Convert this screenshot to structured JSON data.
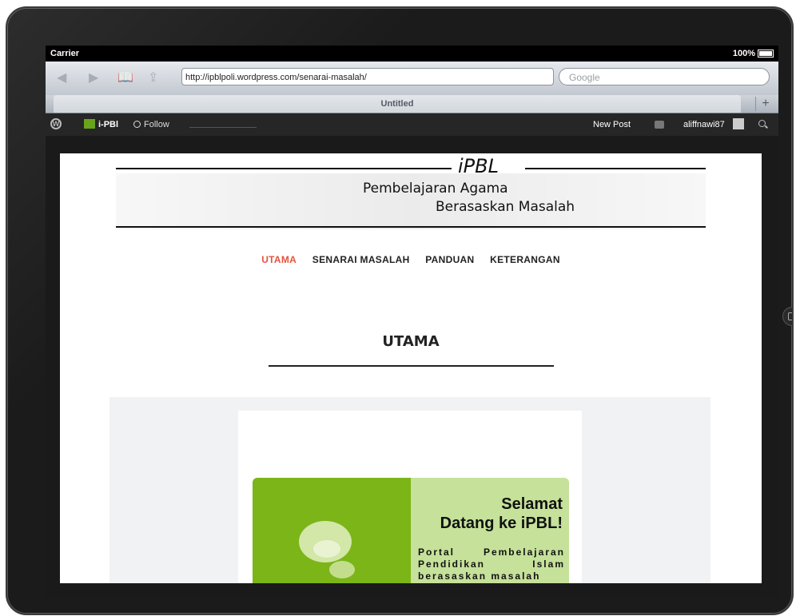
{
  "statusbar": {
    "carrier": "Carrier",
    "battery": "100%"
  },
  "browser": {
    "url": "http://ipblpoli.wordpress.com/senarai-masalah/",
    "search_placeholder": "Google",
    "tab_title": "Untitled",
    "add_tab": "+"
  },
  "adminbar": {
    "site_name": "i-PBl",
    "follow": "Follow",
    "new_post": "New Post",
    "username": "aliffnawi87"
  },
  "site": {
    "title": "iPBL",
    "tagline_line1": "Pembelajaran Agama",
    "tagline_line2": "Berasaskan Masalah"
  },
  "nav": {
    "items": [
      {
        "label": "UTAMA",
        "active": true
      },
      {
        "label": "SENARAI MASALAH",
        "active": false
      },
      {
        "label": "PANDUAN",
        "active": false
      },
      {
        "label": "KETERANGAN",
        "active": false
      }
    ]
  },
  "page": {
    "title": "UTAMA"
  },
  "banner": {
    "welcome_line1": "Selamat",
    "welcome_line2": "Datang ke iPBL!",
    "description": "Portal Pembelajaran Pendidikan Islam berasaskan masalah"
  },
  "colors": {
    "accent": "#e2553f",
    "banner_green": "#7cb518",
    "banner_light": "#c5e19a"
  }
}
